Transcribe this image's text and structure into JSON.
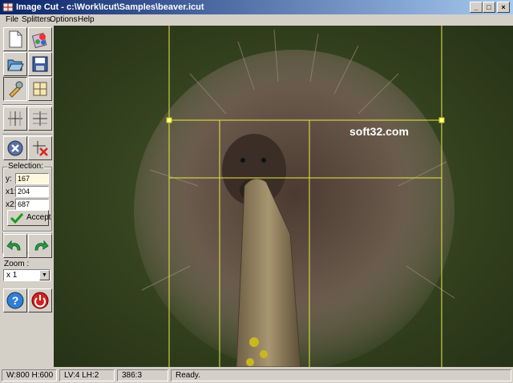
{
  "window": {
    "title": "Image Cut - c:\\Work\\Icut\\Samples\\beaver.icut"
  },
  "menu": [
    "File",
    "Splitters",
    "Options",
    "Help"
  ],
  "toolbar": {
    "new": "new-document-icon",
    "paint": "paint-icon",
    "open": "open-folder-icon",
    "save": "save-disk-icon",
    "edit": "edit-tool-icon",
    "grid": "grid-icon",
    "split_v": "split-vertical-icon",
    "split_h": "split-horizontal-icon",
    "cancel": "cancel-icon",
    "delete": "delete-splitter-icon",
    "undo": "undo-icon",
    "redo": "redo-icon",
    "help": "help-icon",
    "exit": "exit-icon"
  },
  "selection": {
    "label": "Selection:",
    "fields": [
      {
        "label": "y:",
        "value": "167"
      },
      {
        "label": "x1:",
        "value": "204"
      },
      {
        "label": "x2:",
        "value": "687"
      }
    ],
    "accept": "Accept"
  },
  "zoom": {
    "label": "Zoom :",
    "value": "x 1"
  },
  "watermark": "soft32.com",
  "status": [
    "W:800 H:600",
    "LV:4 LH:2",
    "386:3",
    "Ready."
  ],
  "colors": {
    "title_start": "#0a246a",
    "title_end": "#a6caf0",
    "guides": "#e8e84a"
  }
}
